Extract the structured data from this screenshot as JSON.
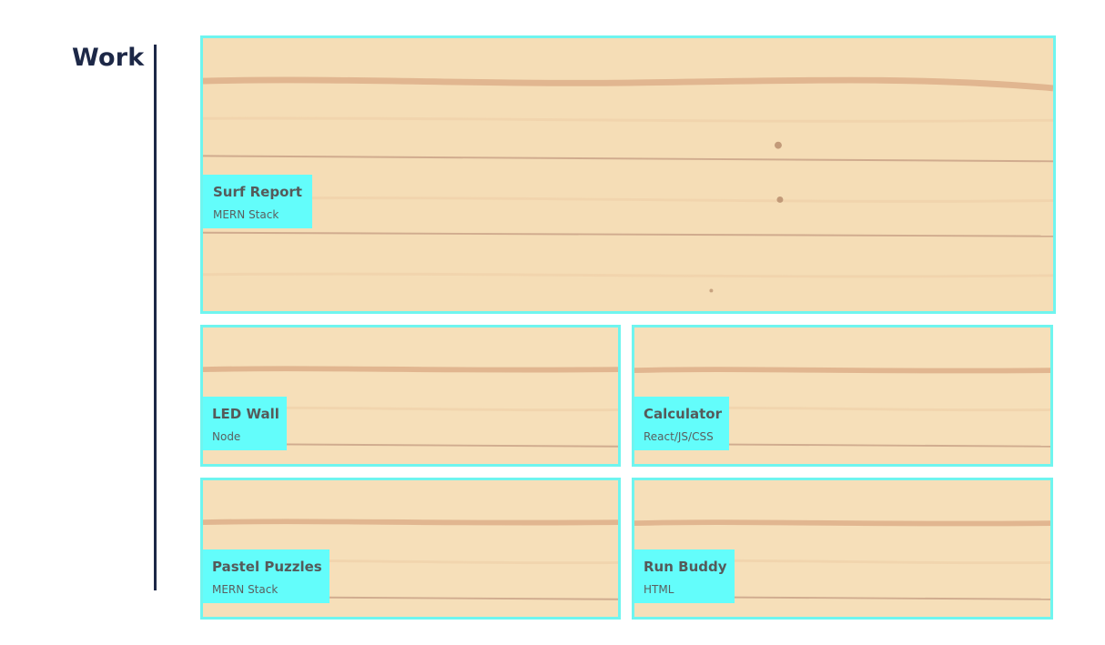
{
  "section": {
    "title": "Work"
  },
  "projects": [
    {
      "name": "Surf Report",
      "tech": "MERN Stack"
    },
    {
      "name": "LED Wall",
      "tech": "Node"
    },
    {
      "name": "Calculator",
      "tech": "React/JS/CSS"
    },
    {
      "name": "Pastel Puzzles",
      "tech": "MERN Stack"
    },
    {
      "name": "Run Buddy",
      "tech": "HTML"
    }
  ],
  "colors": {
    "accent": "#63fdfb",
    "border": "#6ff5ef",
    "heading": "#1d2847",
    "wood": "#f6dfb9"
  }
}
